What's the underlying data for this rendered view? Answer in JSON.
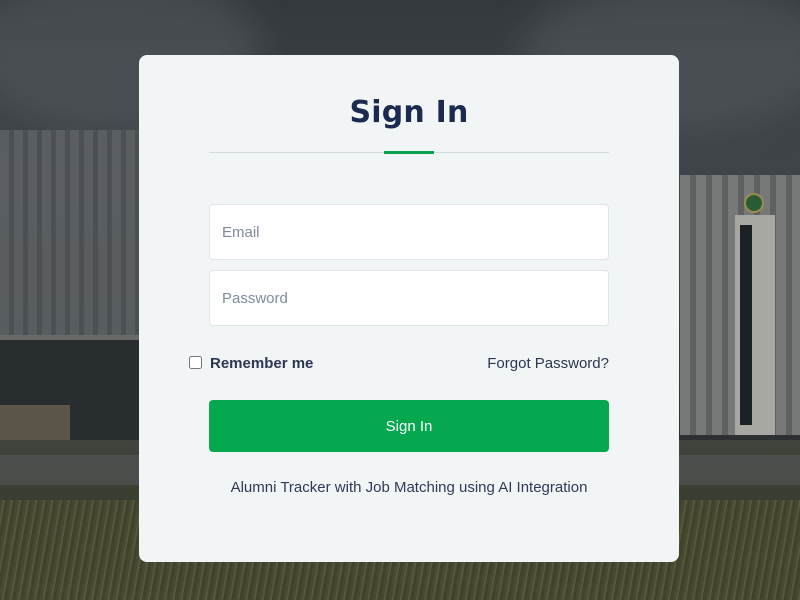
{
  "colors": {
    "title": "#1b2a4e",
    "accent": "#0aa24f",
    "button": "#05a84e",
    "card_background": "#f2f5f5"
  },
  "login": {
    "title": "Sign In",
    "email_placeholder": "Email",
    "password_placeholder": "Password",
    "remember_label": "Remember me",
    "remember_checked": false,
    "forgot_label": "Forgot Password?",
    "submit_label": "Sign In",
    "footer_text": "Alumni Tracker with Job Matching using AI Integration"
  },
  "background": {
    "image_semantic": "campus-buildings-photo"
  }
}
